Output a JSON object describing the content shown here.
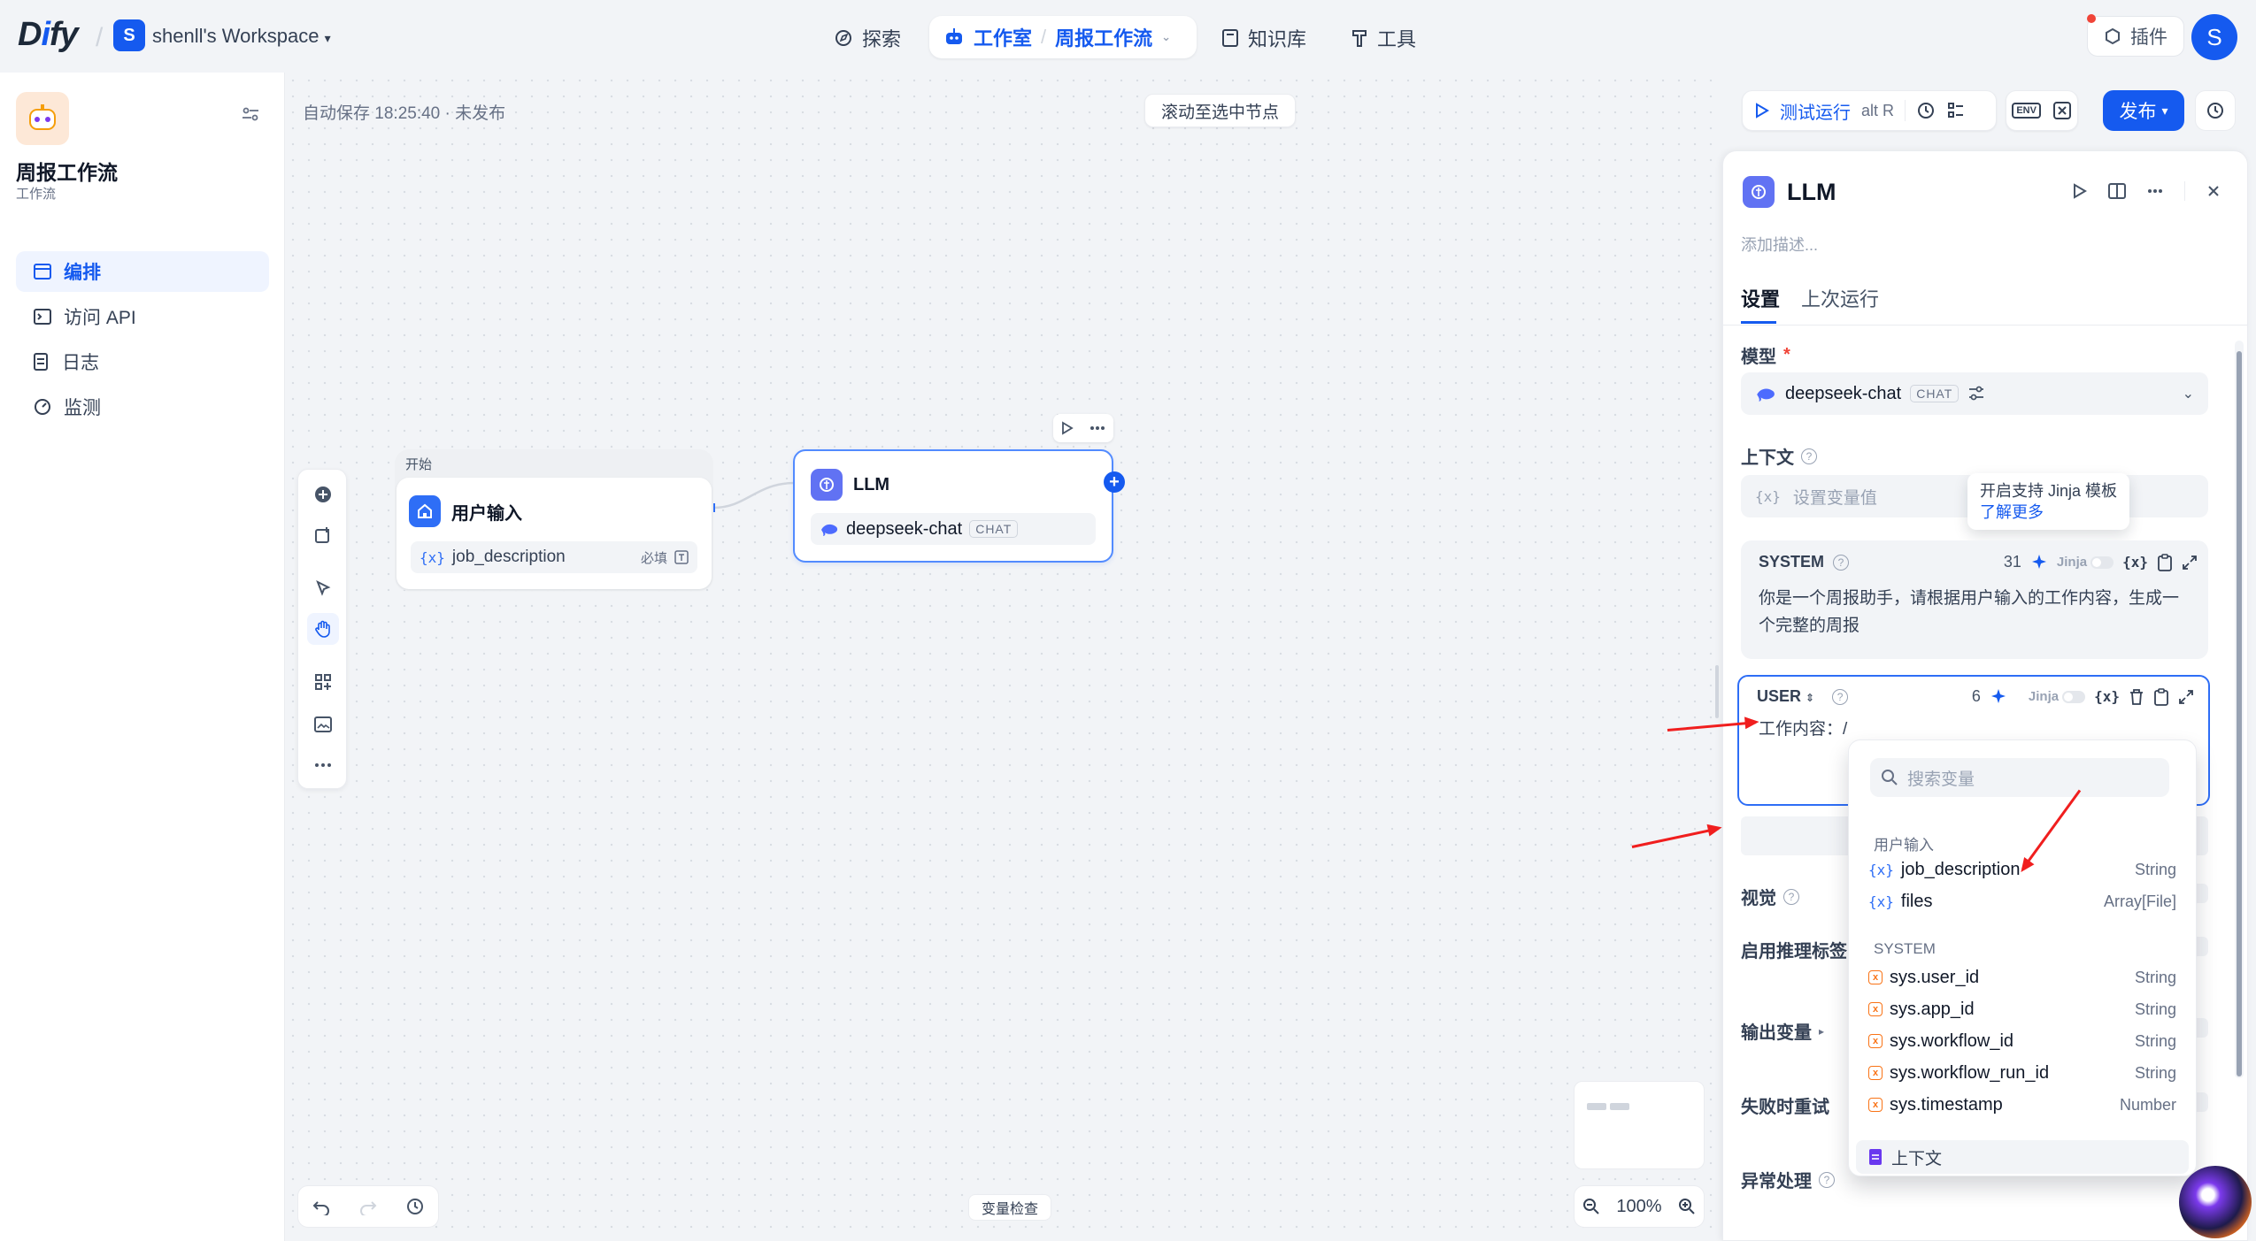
{
  "topbar": {
    "logo": "Dify",
    "workspace_initial": "S",
    "workspace_name": "shenll's Workspace",
    "nav": {
      "explore": "探索",
      "studio": "工作室",
      "current_app": "周报工作流",
      "knowledge": "知识库",
      "tools": "工具"
    },
    "plugins": "插件",
    "user_initial": "S"
  },
  "sidebar": {
    "app_title": "周报工作流",
    "app_type": "工作流",
    "items": [
      {
        "label": "编排",
        "icon": "layout-icon",
        "active": true
      },
      {
        "label": "访问 API",
        "icon": "terminal-icon",
        "active": false
      },
      {
        "label": "日志",
        "icon": "file-list-icon",
        "active": false
      },
      {
        "label": "监测",
        "icon": "dashboard-icon",
        "active": false
      }
    ]
  },
  "canvas": {
    "autosave": "自动保存 18:25:40 · 未发布",
    "scroll_to_node": "滚动至选中节点",
    "var_inspect": "变量检查",
    "zoom": "100%"
  },
  "toolbar": {
    "test_run": "测试运行",
    "shortcut": "alt  R",
    "env": "ENV",
    "publish": "发布"
  },
  "nodes": {
    "start": {
      "group_label": "开始",
      "title": "用户输入",
      "var_symbol": "{x}",
      "var_name": "job_description",
      "required": "必填"
    },
    "llm": {
      "title": "LLM",
      "model": "deepseek-chat",
      "model_tag": "CHAT"
    }
  },
  "panel": {
    "title": "LLM",
    "desc_placeholder": "添加描述...",
    "tabs": [
      "设置",
      "上次运行"
    ],
    "model_label": "模型",
    "required_mark": "*",
    "model_name": "deepseek-chat",
    "model_tag": "CHAT",
    "context_label": "上下文",
    "context_placeholder": "设置变量值",
    "tooltip_text": "开启支持 Jinja 模板",
    "tooltip_link": "了解更多",
    "system": {
      "role": "SYSTEM",
      "count": "31",
      "jinja": "Jinja",
      "text": "你是一个周报助手，请根据用户输入的工作内容，生成一个完整的周报"
    },
    "user": {
      "role": "USER",
      "count": "6",
      "jinja": "Jinja",
      "text": "工作内容：/"
    },
    "sections": {
      "vision": "视觉",
      "reasoning": "启用推理标签",
      "output": "输出变量",
      "retry": "失败时重试",
      "error": "异常处理"
    }
  },
  "var_dropdown": {
    "search_placeholder": "搜索变量",
    "groups": [
      {
        "name": "用户输入",
        "items": [
          {
            "name": "job_description",
            "type": "String"
          },
          {
            "name": "files",
            "type": "Array[File]"
          }
        ]
      },
      {
        "name": "SYSTEM",
        "items": [
          {
            "name": "sys.user_id",
            "type": "String"
          },
          {
            "name": "sys.app_id",
            "type": "String"
          },
          {
            "name": "sys.workflow_id",
            "type": "String"
          },
          {
            "name": "sys.workflow_run_id",
            "type": "String"
          },
          {
            "name": "sys.timestamp",
            "type": "Number"
          }
        ]
      }
    ],
    "context_item": "上下文"
  },
  "colors": {
    "accent": "#155aef",
    "annotation_arrow": "#f01e1e"
  }
}
